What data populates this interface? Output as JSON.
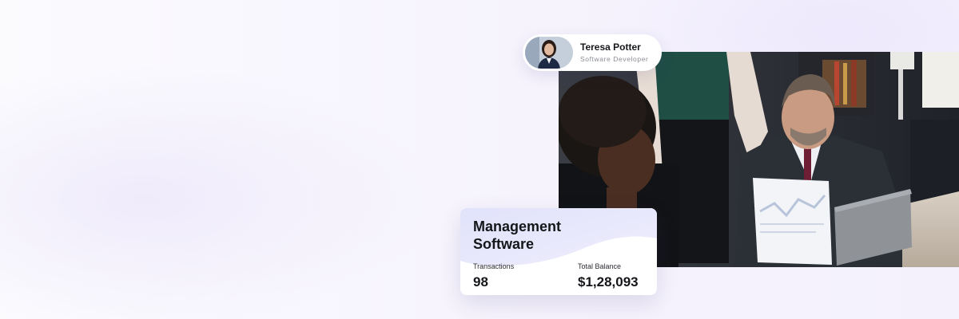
{
  "profile": {
    "name": "Teresa Potter",
    "role": "Software Developer"
  },
  "card": {
    "title": "Management Software",
    "transactions": {
      "label": "Transactions",
      "value": "98"
    },
    "balance": {
      "label": "Total Balance",
      "value": "$1,28,093"
    }
  },
  "colors": {
    "card_wave_top": "#e3e1fa",
    "accent": "#15161a",
    "muted_text": "#8a8d95"
  }
}
